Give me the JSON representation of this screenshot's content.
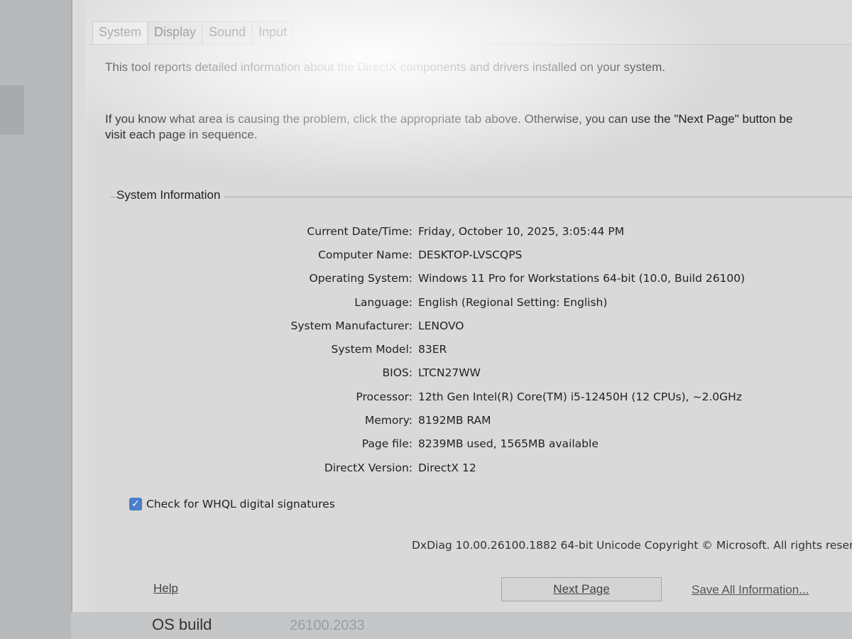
{
  "tabs": [
    "System",
    "Display",
    "Sound",
    "Input"
  ],
  "intro": "This tool reports detailed information about the DirectX components and drivers installed on your system.",
  "instructions": "If you know what area is causing the problem, click the appropriate tab above.  Otherwise, you can use the \"Next Page\" button be\nvisit each page in sequence.",
  "system_info": {
    "title": "System Information",
    "rows": [
      {
        "label": "Current Date/Time:",
        "value": "Friday, October 10, 2025, 3:05:44 PM"
      },
      {
        "label": "Computer Name:",
        "value": "DESKTOP-LVSCQPS"
      },
      {
        "label": "Operating System:",
        "value": "Windows 11 Pro for Workstations 64-bit (10.0, Build 26100)"
      },
      {
        "label": "Language:",
        "value": "English (Regional Setting: English)"
      },
      {
        "label": "System Manufacturer:",
        "value": "LENOVO"
      },
      {
        "label": "System Model:",
        "value": "83ER"
      },
      {
        "label": "BIOS:",
        "value": "LTCN27WW"
      },
      {
        "label": "Processor:",
        "value": "12th Gen Intel(R) Core(TM) i5-12450H (12 CPUs), ~2.0GHz"
      },
      {
        "label": "Memory:",
        "value": "8192MB RAM"
      },
      {
        "label": "Page file:",
        "value": "8239MB used, 1565MB available"
      },
      {
        "label": "DirectX Version:",
        "value": "DirectX 12"
      }
    ]
  },
  "whql": {
    "label": "Check for WHQL digital signatures",
    "checked": true
  },
  "version_text": "DxDiag 10.00.26100.1882 64-bit Unicode  Copyright © Microsoft. All rights reser",
  "buttons": {
    "help": "Help",
    "next": "Next Page",
    "save": "Save All Information..."
  },
  "os_build": {
    "label": "OS build",
    "value": "26100.2033"
  },
  "colors": {
    "checkbox": "#4a7ec8"
  }
}
